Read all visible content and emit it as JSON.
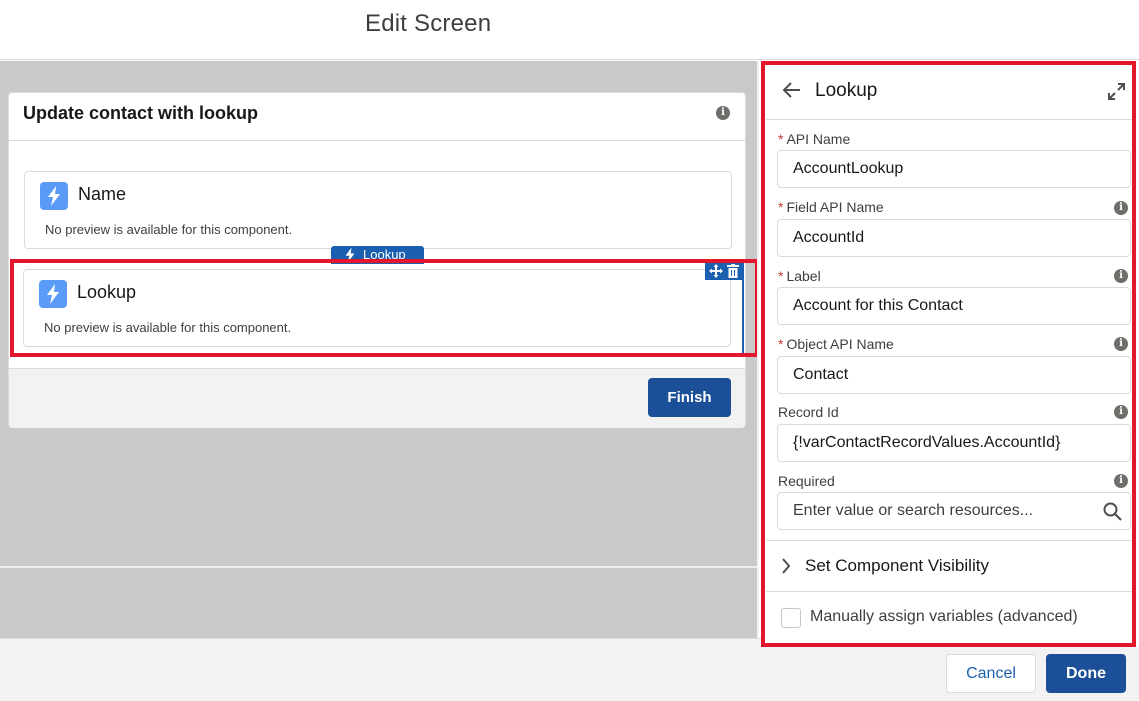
{
  "modal": {
    "title": "Edit Screen"
  },
  "screen": {
    "title": "Update contact with lookup",
    "info_glyph": "i",
    "components": [
      {
        "title": "Name",
        "description": "No preview is available for this component."
      },
      {
        "title": "Lookup",
        "description": "No preview is available for this component."
      }
    ],
    "drag_chip_label": "Lookup",
    "finish_label": "Finish"
  },
  "panel": {
    "title": "Lookup",
    "fields": [
      {
        "label": "API Name",
        "required": "*",
        "value": "AccountLookup"
      },
      {
        "label": "Field API Name",
        "required": "*",
        "value": "AccountId"
      },
      {
        "label": "Label",
        "required": "*",
        "value": "Account for this Contact"
      },
      {
        "label": "Object API Name",
        "required": "*",
        "value": "Contact"
      },
      {
        "label": "Record Id",
        "value": "{!varContactRecordValues.AccountId}"
      },
      {
        "label": "Required",
        "placeholder": "Enter value or search resources..."
      }
    ],
    "visibility_label": "Set Component Visibility",
    "manual_assign_label": "Manually assign variables (advanced)"
  },
  "footer": {
    "cancel_label": "Cancel",
    "done_label": "Done"
  },
  "colors": {
    "brand": "#1b4f97",
    "highlight": "#e3162b",
    "icon": "#5b9bf8"
  },
  "icons": [
    "lightning-icon",
    "info-icon",
    "move-icon",
    "trash-icon",
    "back-arrow-icon",
    "expand-icon",
    "search-icon",
    "chevron-right-icon"
  ]
}
